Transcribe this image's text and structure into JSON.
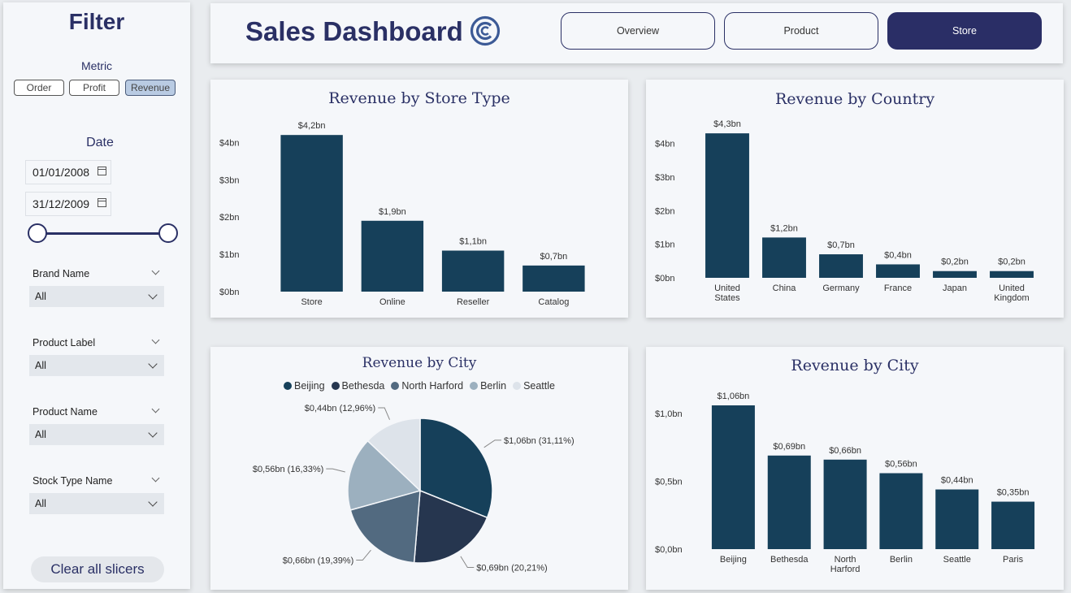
{
  "sidebar": {
    "title": "Filter",
    "metric_label": "Metric",
    "metrics": [
      "Order",
      "Profit",
      "Revenue"
    ],
    "date_label": "Date",
    "date_from": "01/01/2008",
    "date_to": "31/12/2009",
    "slicers": [
      {
        "title": "Brand Name",
        "value": "All"
      },
      {
        "title": "Product Label",
        "value": "All"
      },
      {
        "title": "Product Name",
        "value": "All"
      },
      {
        "title": "Stock Type Name",
        "value": "All"
      }
    ],
    "clear_label": "Clear all slicers"
  },
  "header": {
    "title": "Sales Dashboard",
    "nav": [
      "Overview",
      "Product",
      "Store"
    ]
  },
  "colors": {
    "bar": "#16405a",
    "accent": "#2a3065",
    "pie": [
      "#16405a",
      "#26364f",
      "#526a80",
      "#9cb0bf",
      "#dde3ea"
    ]
  },
  "chart_data": [
    {
      "type": "bar",
      "title": "Revenue by Store Type",
      "categories": [
        "Store",
        "Online",
        "Reseller",
        "Catalog"
      ],
      "values": [
        4.2,
        1.9,
        1.1,
        0.7
      ],
      "data_labels": [
        "$4,2bn",
        "$1,9bn",
        "$1,1bn",
        "$0,7bn"
      ],
      "yticks": [
        0,
        1,
        2,
        3,
        4
      ],
      "ytick_labels": [
        "$0bn",
        "$1bn",
        "$2bn",
        "$3bn",
        "$4bn"
      ],
      "ylim": [
        0,
        4.4
      ]
    },
    {
      "type": "bar",
      "title": "Revenue by Country",
      "categories": [
        [
          "United",
          "States"
        ],
        [
          "China"
        ],
        [
          "Germany"
        ],
        [
          "France"
        ],
        [
          "Japan"
        ],
        [
          "United",
          "Kingdom"
        ]
      ],
      "values": [
        4.3,
        1.2,
        0.7,
        0.4,
        0.2,
        0.2
      ],
      "data_labels": [
        "$4,3bn",
        "$1,2bn",
        "$0,7bn",
        "$0,4bn",
        "$0,2bn",
        "$0,2bn"
      ],
      "yticks": [
        0,
        1,
        2,
        3,
        4
      ],
      "ytick_labels": [
        "$0bn",
        "$1bn",
        "$2bn",
        "$3bn",
        "$4bn"
      ],
      "ylim": [
        0,
        4.4
      ]
    },
    {
      "type": "pie",
      "title": "Revenue by City",
      "labels": [
        "Beijing",
        "Bethesda",
        "North Harford",
        "Berlin",
        "Seattle"
      ],
      "values": [
        1.06,
        0.69,
        0.66,
        0.56,
        0.44
      ],
      "data_labels": [
        "$1,06bn (31,11%)",
        "$0,69bn (20,21%)",
        "$0,66bn (19,39%)",
        "$0,56bn (16,33%)",
        "$0,44bn (12,96%)"
      ],
      "legend": "top"
    },
    {
      "type": "bar",
      "title": "Revenue by City",
      "categories": [
        [
          "Beijing"
        ],
        [
          "Bethesda"
        ],
        [
          "North",
          "Harford"
        ],
        [
          "Berlin"
        ],
        [
          "Seattle"
        ],
        [
          "Paris"
        ]
      ],
      "values": [
        1.06,
        0.69,
        0.66,
        0.56,
        0.44,
        0.35
      ],
      "data_labels": [
        "$1,06bn",
        "$0,69bn",
        "$0,66bn",
        "$0,56bn",
        "$0,44bn",
        "$0,35bn"
      ],
      "yticks": [
        0,
        0.5,
        1.0
      ],
      "ytick_labels": [
        "$0,0bn",
        "$0,5bn",
        "$1,0bn"
      ],
      "ylim": [
        0,
        1.12
      ]
    }
  ]
}
